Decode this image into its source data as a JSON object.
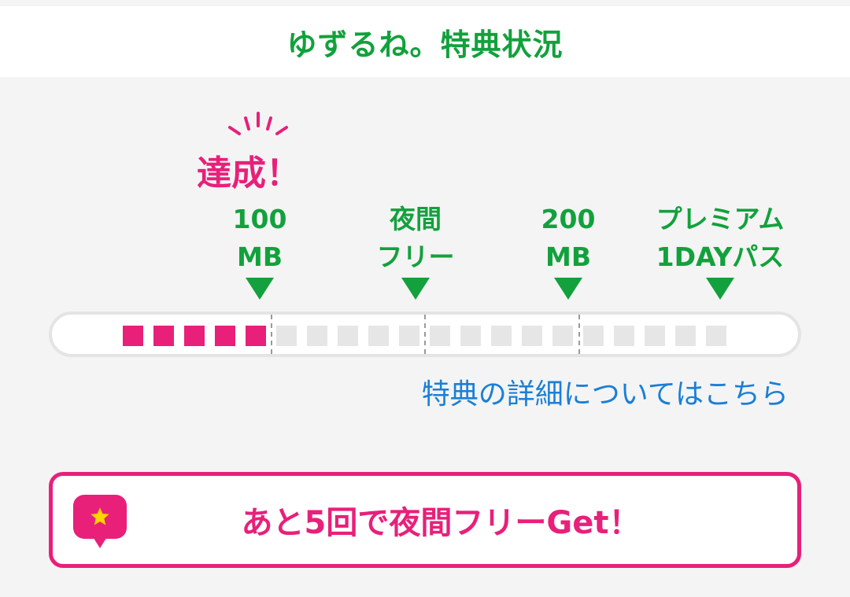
{
  "header": {
    "title": "ゆずるね。特典状況"
  },
  "achievement": {
    "label": "達成！"
  },
  "milestones": [
    {
      "line1": "100",
      "line2": "MB"
    },
    {
      "line1": "夜間",
      "line2": "フリー"
    },
    {
      "line1": "200",
      "line2": "MB"
    },
    {
      "line1": "プレミアム",
      "line2": "1DAYパス"
    }
  ],
  "progress": {
    "filled_segments": 5,
    "total_segments": 20
  },
  "detail_link": {
    "label": "特典の詳細についてはこちら"
  },
  "cta": {
    "label": "あと5回で夜間フリーGet！",
    "icon": "star-icon"
  },
  "colors": {
    "accent_green": "#12a13c",
    "accent_pink": "#e8207a",
    "link_blue": "#1a7fd6"
  }
}
